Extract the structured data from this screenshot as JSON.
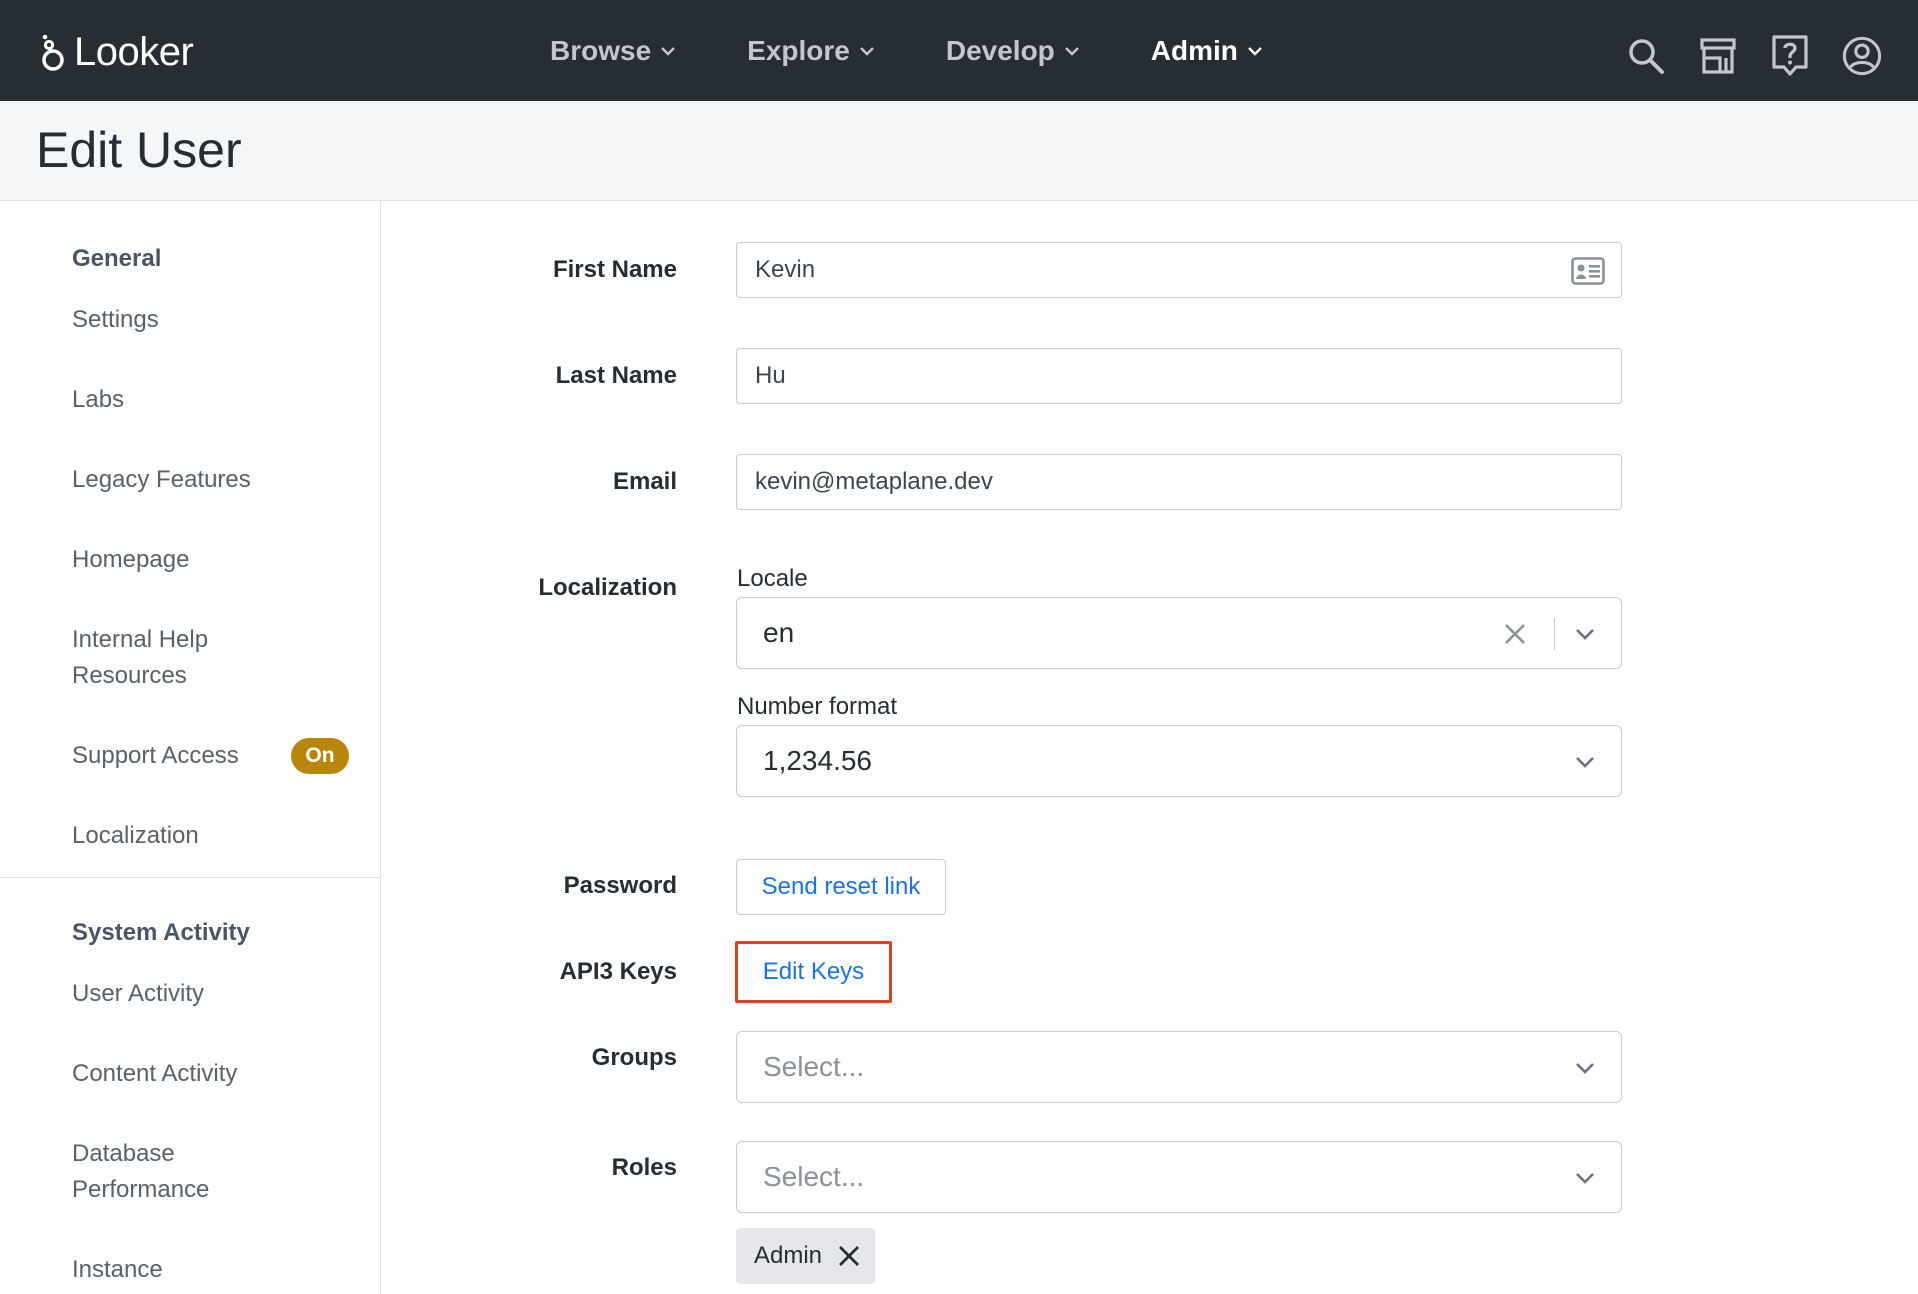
{
  "app": {
    "logo_text": "Looker"
  },
  "nav": {
    "items": [
      {
        "label": "Browse"
      },
      {
        "label": "Explore"
      },
      {
        "label": "Develop"
      },
      {
        "label": "Admin"
      }
    ],
    "active": "Admin",
    "icons": [
      "search-icon",
      "marketplace-icon",
      "help-icon",
      "account-icon"
    ]
  },
  "page": {
    "title": "Edit User"
  },
  "sidebar": {
    "sections": [
      {
        "heading": "General",
        "items": [
          "Settings",
          "Labs",
          "Legacy Features",
          "Homepage",
          "Internal Help Resources",
          "Support Access",
          "Localization"
        ]
      },
      {
        "heading": "System Activity",
        "items": [
          "User Activity",
          "Content Activity",
          "Database Performance",
          "Instance"
        ]
      }
    ],
    "support_access_badge": "On"
  },
  "form": {
    "first_name": {
      "label": "First Name",
      "value": "Kevin"
    },
    "last_name": {
      "label": "Last Name",
      "value": "Hu"
    },
    "email": {
      "label": "Email",
      "value": "kevin@metaplane.dev"
    },
    "localization": {
      "label": "Localization",
      "locale_label": "Locale",
      "locale_value": "en",
      "number_format_label": "Number format",
      "number_format_value": "1,234.56"
    },
    "password": {
      "label": "Password",
      "button": "Send reset link"
    },
    "api3_keys": {
      "label": "API3 Keys",
      "button": "Edit Keys"
    },
    "groups": {
      "label": "Groups",
      "placeholder": "Select..."
    },
    "roles": {
      "label": "Roles",
      "placeholder": "Select...",
      "chips": [
        "Admin"
      ]
    }
  },
  "colors": {
    "topbar": "#262d33",
    "link": "#1a73e8",
    "highlight": "#e53d24",
    "badge": "#b8860b"
  }
}
